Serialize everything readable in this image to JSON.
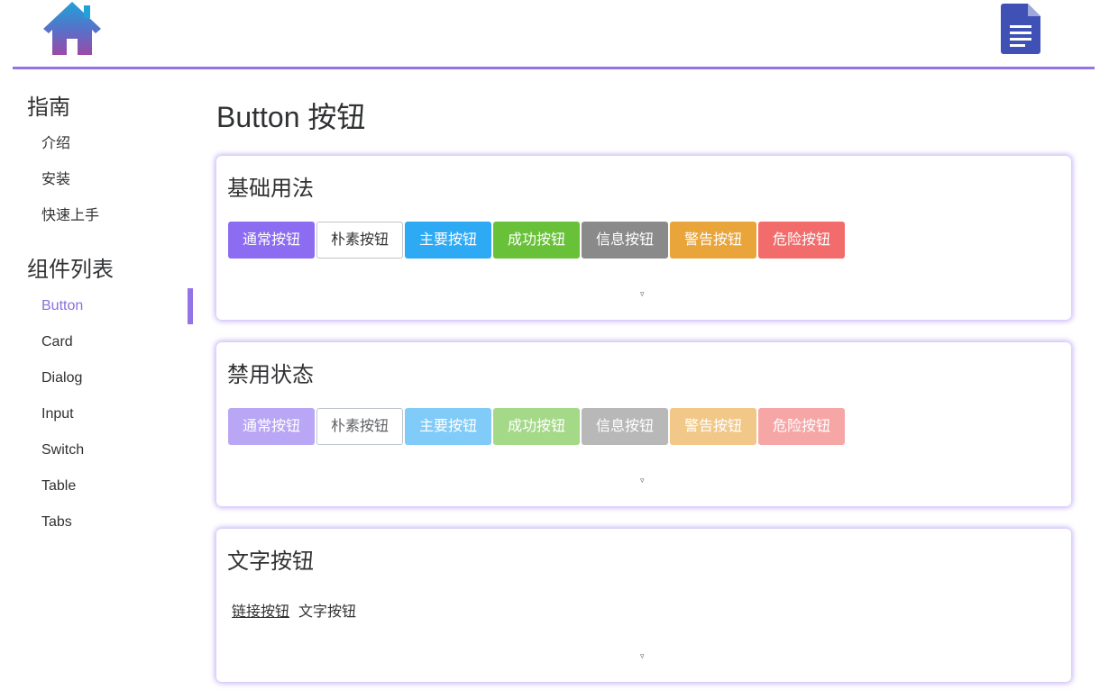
{
  "header": {
    "logo_icon": "house-icon",
    "doc_icon": "document-icon"
  },
  "sidebar": {
    "guide_title": "指南",
    "guide_items": [
      {
        "label": "介绍"
      },
      {
        "label": "安装"
      },
      {
        "label": "快速上手"
      }
    ],
    "components_title": "组件列表",
    "component_items": [
      {
        "label": "Button",
        "active": true
      },
      {
        "label": "Card"
      },
      {
        "label": "Dialog"
      },
      {
        "label": "Input"
      },
      {
        "label": "Switch"
      },
      {
        "label": "Table"
      },
      {
        "label": "Tabs"
      }
    ]
  },
  "main": {
    "page_title": "Button 按钮",
    "sections": [
      {
        "title": "基础用法",
        "buttons": [
          "通常按钮",
          "朴素按钮",
          "主要按钮",
          "成功按钮",
          "信息按钮",
          "警告按钮",
          "危险按钮"
        ],
        "toggle": "▿"
      },
      {
        "title": "禁用状态",
        "buttons": [
          "通常按钮",
          "朴素按钮",
          "主要按钮",
          "成功按钮",
          "信息按钮",
          "警告按钮",
          "危险按钮"
        ],
        "toggle": "▿"
      },
      {
        "title": "文字按钮",
        "link_button": "链接按钮",
        "text_button": "文字按钮",
        "toggle": "▿"
      }
    ]
  },
  "colors": {
    "accent": "#9373e6",
    "normal": "#8c6cf0",
    "primary": "#2eaaf5",
    "success": "#69c13a",
    "info": "#8a8a8a",
    "warning": "#e9a43a",
    "danger": "#f26c6c"
  }
}
